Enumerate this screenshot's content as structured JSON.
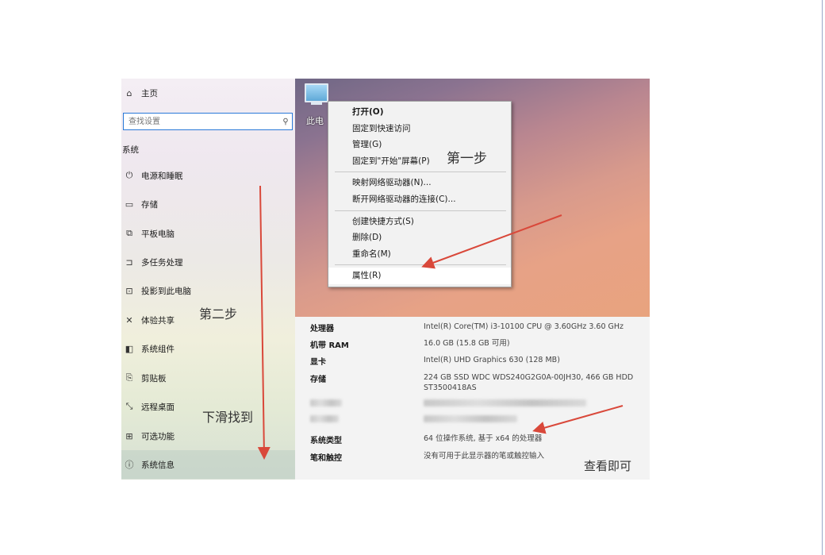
{
  "settings": {
    "home_label": "主页",
    "search_placeholder": "查找设置",
    "section_title": "系统",
    "items": [
      {
        "label": "电源和睡眠",
        "icon": "power-icon"
      },
      {
        "label": "存储",
        "icon": "storage-icon"
      },
      {
        "label": "平板电脑",
        "icon": "tablet-icon"
      },
      {
        "label": "多任务处理",
        "icon": "multitasking-icon"
      },
      {
        "label": "投影到此电脑",
        "icon": "projecting-icon"
      },
      {
        "label": "体验共享",
        "icon": "shared-experience-icon"
      },
      {
        "label": "系统组件",
        "icon": "system-components-icon"
      },
      {
        "label": "剪贴板",
        "icon": "clipboard-icon"
      },
      {
        "label": "远程桌面",
        "icon": "remote-desktop-icon"
      },
      {
        "label": "可选功能",
        "icon": "optional-features-icon"
      },
      {
        "label": "系统信息",
        "icon": "info-icon"
      }
    ]
  },
  "desktop": {
    "icon_label": "此电"
  },
  "context_menu": {
    "items": [
      {
        "label": "打开(O)"
      },
      {
        "label": "固定到快速访问"
      },
      {
        "label": "管理(G)"
      },
      {
        "label": "固定到\"开始\"屏幕(P)"
      },
      {
        "label": "映射网络驱动器(N)..."
      },
      {
        "label": "断开网络驱动器的连接(C)..."
      },
      {
        "label": "创建快捷方式(S)"
      },
      {
        "label": "删除(D)"
      },
      {
        "label": "重命名(M)"
      },
      {
        "label": "属性(R)"
      }
    ]
  },
  "properties": {
    "rows": [
      {
        "key": "处理器",
        "value": "Intel(R) Core(TM) i3-10100 CPU @ 3.60GHz   3.60 GHz"
      },
      {
        "key": "机带 RAM",
        "value": "16.0 GB (15.8 GB 可用)"
      },
      {
        "key": "显卡",
        "value": "Intel(R) UHD Graphics 630 (128 MB)"
      },
      {
        "key": "存储",
        "value": "224 GB SSD WDC WDS240G2G0A-00JH30, 466 GB HDD ST3500418AS"
      },
      {
        "key": "系统类型",
        "value": "64 位操作系统, 基于 x64 的处理器"
      },
      {
        "key": "笔和触控",
        "value": "没有可用于此显示器的笔或触控输入"
      }
    ]
  },
  "annotations": {
    "step1": "第一步",
    "step2": "第二步",
    "scroll_hint": "下滑找到",
    "check_hint": "查看即可",
    "arrow_color": "#d9483a"
  }
}
